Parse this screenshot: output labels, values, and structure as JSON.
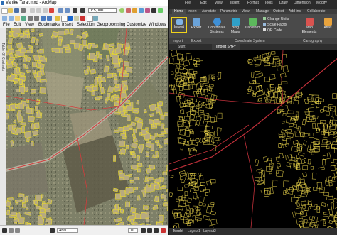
{
  "arcmap": {
    "title": "Vanike Tarar.mxd - ArcMap",
    "menu": [
      "File",
      "Edit",
      "View",
      "Bookmarks",
      "Insert",
      "Selection",
      "Geoprocessing",
      "Customize",
      "Windows"
    ],
    "scale_value": "1:5,000",
    "side_tab_label": "Table Of Contents",
    "font_name": "Arial",
    "font_size": "10"
  },
  "autocad": {
    "menu": [
      "File",
      "Edit",
      "View",
      "Insert",
      "Format",
      "Tools",
      "Draw",
      "Dimension",
      "Modify"
    ],
    "ribbon_tabs": [
      "Home",
      "Insert",
      "Annotate",
      "Parametric",
      "View",
      "Manage",
      "Output",
      "Add-ins",
      "Collaborate"
    ],
    "ribbon_buttons": [
      "Import",
      "Export",
      "Coordinate Systems",
      "Bing Maps",
      "Transform"
    ],
    "coord_list": [
      "Change Units",
      "Scale Factor",
      "QR Code"
    ],
    "cartography_buttons": [
      "Map Elements",
      "Atlas"
    ],
    "panels": [
      "Import",
      "Export",
      "Coordinate System",
      "Cartography"
    ],
    "doc_tabs": [
      "Start",
      "Import SHP*"
    ],
    "layout_tabs": [
      "Model",
      "Layout1",
      "Layout2"
    ]
  },
  "colors": {
    "cad_parcel_line": "#e8d24a",
    "cad_road_line": "#c0303a",
    "arcmap_parcel_line": "#f0e020",
    "arcmap_road_line": "#d23c3c",
    "ribbon_bg": "#4a4a4a",
    "import_highlight": "#f2d31b"
  }
}
